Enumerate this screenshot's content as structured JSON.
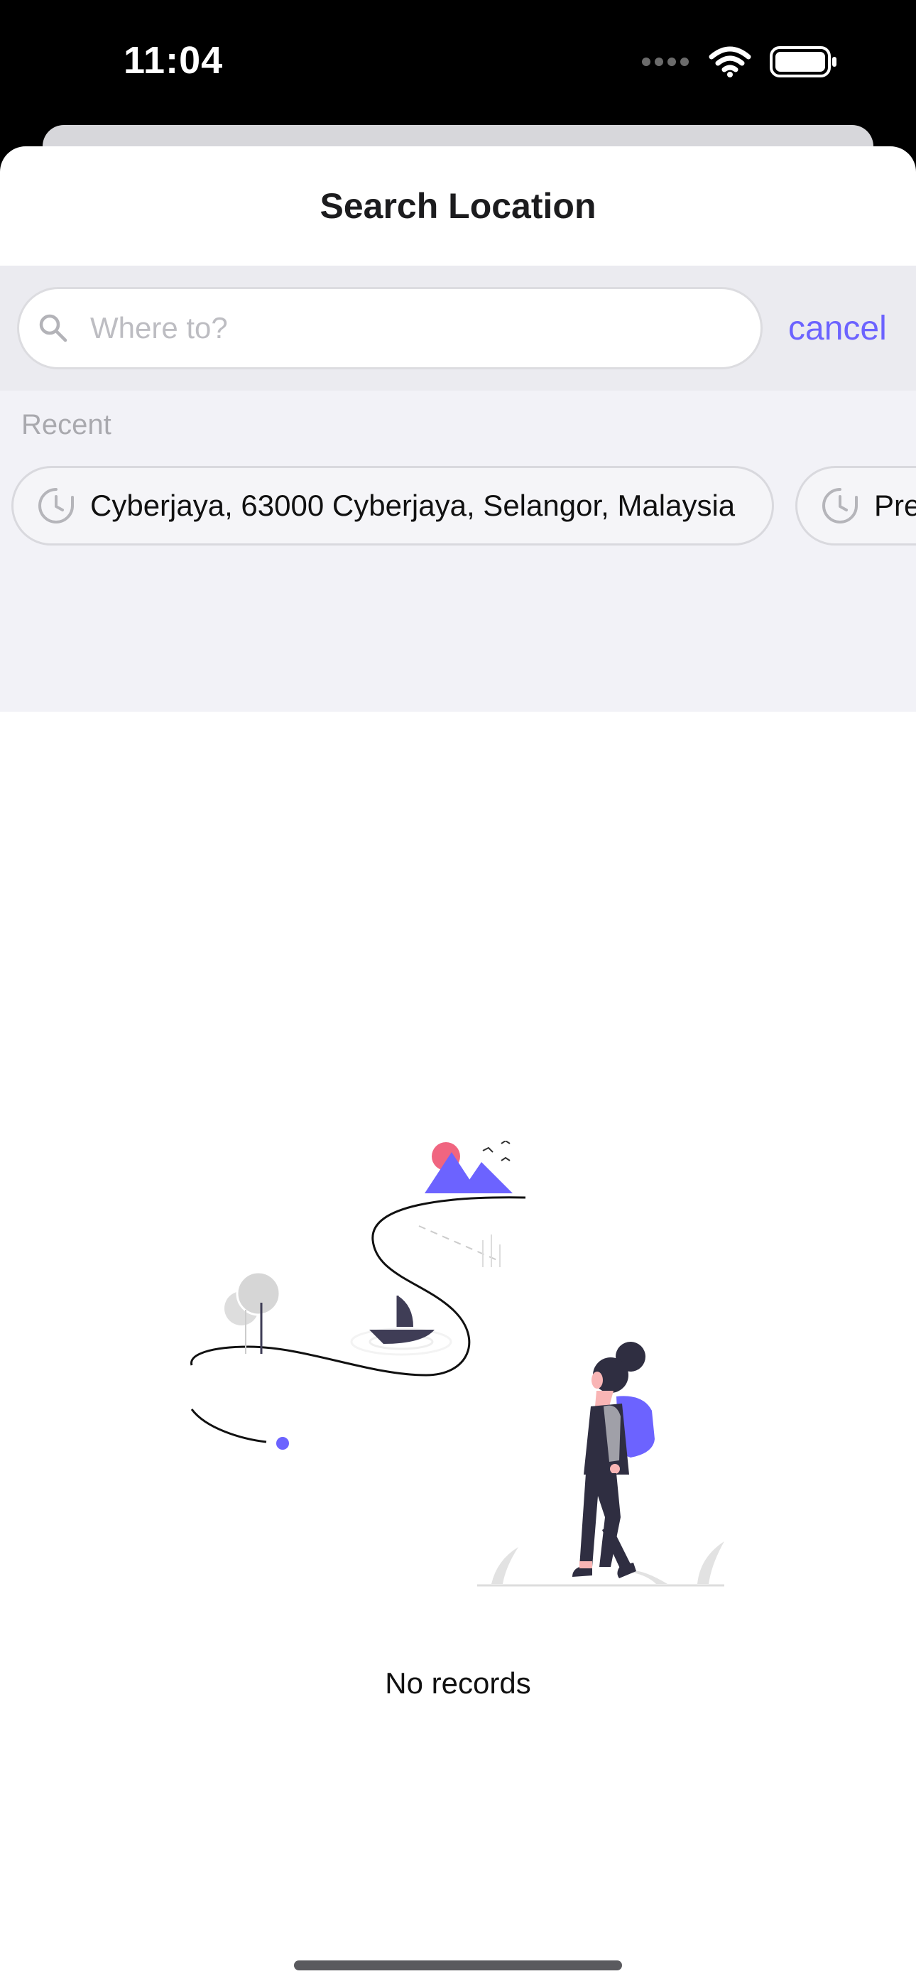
{
  "status_bar": {
    "time": "11:04"
  },
  "sheet": {
    "title": "Search Location"
  },
  "search": {
    "placeholder": "Where to?",
    "value": "",
    "cancel_label": "cancel"
  },
  "recent": {
    "label": "Recent",
    "items": [
      {
        "label": "Cyberjaya, 63000 Cyberjaya, Selangor, Malaysia",
        "icon": "clock-icon"
      },
      {
        "label": "Pres",
        "icon": "clock-icon"
      }
    ]
  },
  "empty_state": {
    "message": "No records",
    "illustration": "traveler-walking-illustration"
  },
  "colors": {
    "accent": "#6c63ff",
    "sun": "#f06580",
    "background": "#ffffff",
    "panel": "#f2f2f7"
  }
}
